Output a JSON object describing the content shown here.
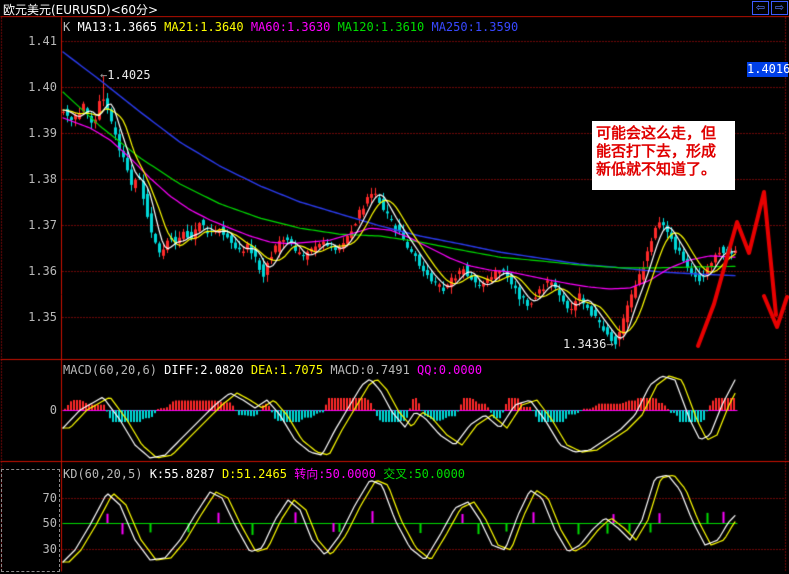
{
  "window": {
    "title": "欧元美元(EURUSD)<60分>",
    "back_icon": "⇦",
    "forward_icon": "⇨"
  },
  "colors": {
    "grid_red": "#e01010",
    "up_candle": "#ff2a2a",
    "down_candle": "#00d8d8",
    "white": "#ffffff",
    "yellow": "#ffff00",
    "magenta": "#ff00ff",
    "green": "#00dd00",
    "blue": "#2b3cf0",
    "gray_text": "#b8b8b8",
    "badge_bg": "#0040e8",
    "note_red": "#e00000",
    "arrow_red": "#e80000"
  },
  "main_panel": {
    "legend_k": "K",
    "legend": [
      {
        "label": "MA13:1.3665",
        "color": "#ffffff"
      },
      {
        "label": "MA21:1.3640",
        "color": "#ffff00"
      },
      {
        "label": "MA60:1.3630",
        "color": "#ff00ff"
      },
      {
        "label": "MA120:1.3610",
        "color": "#00dd00"
      },
      {
        "label": "MA250:1.3590",
        "color": "#3848ff"
      }
    ],
    "y_axis_labels": [
      "1.41",
      "1.40",
      "1.39",
      "1.38",
      "1.37",
      "1.36",
      "1.35"
    ],
    "price_badge": "1.4016",
    "high_label": {
      "arrow": "←",
      "text": "1.4025"
    },
    "low_label": {
      "text": "1.3436",
      "arrow": "→"
    },
    "note": {
      "lines": [
        "可能会这么走，但",
        "能否打下去，形成",
        "新低就不知道了。"
      ]
    }
  },
  "macd_panel": {
    "header": [
      {
        "label": "MACD(60,20,6)",
        "color": "#b8b8b8"
      },
      {
        "label": "DIFF:2.0820",
        "color": "#ffffff"
      },
      {
        "label": "DEA:1.7075",
        "color": "#ffff00"
      },
      {
        "label": "MACD:0.7491",
        "color": "#b8b8b8"
      },
      {
        "label": "QQ:0.0000",
        "color": "#ff00ff"
      }
    ],
    "zero_label": "0"
  },
  "kd_panel": {
    "header": [
      {
        "label": "KD(60,20,5)",
        "color": "#b8b8b8"
      },
      {
        "label": "K:55.8287",
        "color": "#ffffff"
      },
      {
        "label": "D:51.2465",
        "color": "#ffff00"
      },
      {
        "label": "转向:50.0000",
        "color": "#ff00ff"
      },
      {
        "label": "交叉:50.0000",
        "color": "#00dd00"
      }
    ],
    "y_axis_labels": [
      "70",
      "50",
      "30"
    ]
  },
  "chart_data": {
    "type": "candlestick+indicators",
    "symbol": "EURUSD",
    "period": "60分",
    "price_axis": {
      "top_price": 1.41,
      "price_step": 0.01,
      "labels": [
        1.41,
        1.4,
        1.39,
        1.38,
        1.37,
        1.36,
        1.35
      ]
    },
    "high_point": 1.4025,
    "low_point": 1.3436,
    "last_marked_price": 1.4016,
    "price_path": [
      [
        63,
        1.395
      ],
      [
        75,
        1.3928
      ],
      [
        85,
        1.3961
      ],
      [
        95,
        1.3917
      ],
      [
        103,
        1.3993
      ],
      [
        110,
        1.3939
      ],
      [
        118,
        1.3885
      ],
      [
        125,
        1.3841
      ],
      [
        133,
        1.3787
      ],
      [
        140,
        1.3809
      ],
      [
        148,
        1.3733
      ],
      [
        155,
        1.3667
      ],
      [
        162,
        1.3628
      ],
      [
        170,
        1.3678
      ],
      [
        178,
        1.365
      ],
      [
        185,
        1.3689
      ],
      [
        193,
        1.3667
      ],
      [
        200,
        1.3707
      ],
      [
        210,
        1.3678
      ],
      [
        220,
        1.3693
      ],
      [
        230,
        1.3672
      ],
      [
        240,
        1.3641
      ],
      [
        250,
        1.3657
      ],
      [
        258,
        1.362
      ],
      [
        265,
        1.3591
      ],
      [
        272,
        1.3635
      ],
      [
        280,
        1.3657
      ],
      [
        288,
        1.3672
      ],
      [
        295,
        1.3646
      ],
      [
        305,
        1.3628
      ],
      [
        315,
        1.365
      ],
      [
        325,
        1.3667
      ],
      [
        335,
        1.3641
      ],
      [
        345,
        1.3663
      ],
      [
        355,
        1.37
      ],
      [
        365,
        1.3743
      ],
      [
        372,
        1.3776
      ],
      [
        380,
        1.3759
      ],
      [
        388,
        1.3722
      ],
      [
        395,
        1.37
      ],
      [
        405,
        1.3667
      ],
      [
        415,
        1.3635
      ],
      [
        425,
        1.3602
      ],
      [
        435,
        1.3576
      ],
      [
        445,
        1.3559
      ],
      [
        455,
        1.3585
      ],
      [
        465,
        1.3607
      ],
      [
        472,
        1.3585
      ],
      [
        480,
        1.3563
      ],
      [
        490,
        1.358
      ],
      [
        500,
        1.3602
      ],
      [
        510,
        1.3585
      ],
      [
        520,
        1.3548
      ],
      [
        530,
        1.3526
      ],
      [
        540,
        1.3559
      ],
      [
        550,
        1.3576
      ],
      [
        558,
        1.3554
      ],
      [
        565,
        1.3533
      ],
      [
        572,
        1.3515
      ],
      [
        580,
        1.3548
      ],
      [
        588,
        1.3526
      ],
      [
        595,
        1.3504
      ],
      [
        602,
        1.3483
      ],
      [
        610,
        1.3461
      ],
      [
        618,
        1.3441
      ],
      [
        625,
        1.3493
      ],
      [
        632,
        1.3537
      ],
      [
        640,
        1.358
      ],
      [
        648,
        1.3635
      ],
      [
        655,
        1.3685
      ],
      [
        662,
        1.3707
      ],
      [
        670,
        1.3678
      ],
      [
        678,
        1.365
      ],
      [
        685,
        1.3624
      ],
      [
        692,
        1.3598
      ],
      [
        700,
        1.358
      ],
      [
        708,
        1.3602
      ],
      [
        715,
        1.3628
      ],
      [
        722,
        1.365
      ],
      [
        728,
        1.3635
      ],
      [
        735,
        1.3646
      ]
    ],
    "ma60": [
      [
        63,
        1.3933
      ],
      [
        90,
        1.3911
      ],
      [
        110,
        1.3885
      ],
      [
        130,
        1.3846
      ],
      [
        150,
        1.3802
      ],
      [
        170,
        1.3763
      ],
      [
        190,
        1.3733
      ],
      [
        210,
        1.3711
      ],
      [
        230,
        1.3693
      ],
      [
        250,
        1.3676
      ],
      [
        270,
        1.3663
      ],
      [
        290,
        1.3659
      ],
      [
        310,
        1.3663
      ],
      [
        330,
        1.3667
      ],
      [
        350,
        1.368
      ],
      [
        370,
        1.3693
      ],
      [
        390,
        1.3689
      ],
      [
        410,
        1.3672
      ],
      [
        430,
        1.365
      ],
      [
        450,
        1.3628
      ],
      [
        470,
        1.3611
      ],
      [
        490,
        1.3602
      ],
      [
        510,
        1.3598
      ],
      [
        530,
        1.3589
      ],
      [
        550,
        1.358
      ],
      [
        570,
        1.3572
      ],
      [
        590,
        1.3565
      ],
      [
        610,
        1.3561
      ],
      [
        630,
        1.3563
      ],
      [
        650,
        1.358
      ],
      [
        670,
        1.3607
      ],
      [
        690,
        1.3624
      ],
      [
        710,
        1.3633
      ],
      [
        735,
        1.363
      ]
    ],
    "ma120": [
      [
        63,
        1.3989
      ],
      [
        100,
        1.3915
      ],
      [
        140,
        1.3846
      ],
      [
        180,
        1.3789
      ],
      [
        220,
        1.3746
      ],
      [
        260,
        1.3715
      ],
      [
        300,
        1.3693
      ],
      [
        340,
        1.368
      ],
      [
        380,
        1.3676
      ],
      [
        420,
        1.3663
      ],
      [
        460,
        1.3646
      ],
      [
        500,
        1.363
      ],
      [
        540,
        1.3622
      ],
      [
        580,
        1.3613
      ],
      [
        620,
        1.3607
      ],
      [
        660,
        1.3607
      ],
      [
        700,
        1.3609
      ],
      [
        735,
        1.361
      ]
    ],
    "ma250": [
      [
        63,
        1.4076
      ],
      [
        100,
        1.4015
      ],
      [
        140,
        1.3946
      ],
      [
        180,
        1.388
      ],
      [
        220,
        1.3828
      ],
      [
        260,
        1.3785
      ],
      [
        300,
        1.375
      ],
      [
        340,
        1.3724
      ],
      [
        380,
        1.3698
      ],
      [
        420,
        1.3676
      ],
      [
        460,
        1.3659
      ],
      [
        500,
        1.3641
      ],
      [
        540,
        1.3628
      ],
      [
        580,
        1.3615
      ],
      [
        620,
        1.3607
      ],
      [
        660,
        1.3598
      ],
      [
        700,
        1.3593
      ],
      [
        735,
        1.359
      ]
    ],
    "macd_diff": [
      [
        63,
        -1.25
      ],
      [
        80,
        0.0
      ],
      [
        103,
        0.9
      ],
      [
        120,
        -0.69
      ],
      [
        135,
        -2.43
      ],
      [
        150,
        -3.33
      ],
      [
        165,
        -3.13
      ],
      [
        180,
        -2.08
      ],
      [
        200,
        -0.69
      ],
      [
        215,
        0.35
      ],
      [
        230,
        1.18
      ],
      [
        243,
        0.69
      ],
      [
        255,
        0.14
      ],
      [
        267,
        0.69
      ],
      [
        280,
        -0.35
      ],
      [
        295,
        -2.08
      ],
      [
        310,
        -2.92
      ],
      [
        322,
        -3.13
      ],
      [
        335,
        -1.39
      ],
      [
        350,
        0.35
      ],
      [
        362,
        1.74
      ],
      [
        370,
        2.15
      ],
      [
        380,
        1.39
      ],
      [
        392,
        -0.14
      ],
      [
        405,
        -1.18
      ],
      [
        415,
        -0.14
      ],
      [
        425,
        -0.56
      ],
      [
        440,
        -1.74
      ],
      [
        455,
        -2.43
      ],
      [
        470,
        -1.04
      ],
      [
        485,
        -0.35
      ],
      [
        500,
        -1.25
      ],
      [
        515,
        0.35
      ],
      [
        530,
        0.69
      ],
      [
        545,
        -0.69
      ],
      [
        560,
        -2.43
      ],
      [
        575,
        -2.92
      ],
      [
        590,
        -2.78
      ],
      [
        605,
        -2.08
      ],
      [
        620,
        -1.39
      ],
      [
        635,
        -0.35
      ],
      [
        650,
        1.74
      ],
      [
        662,
        2.36
      ],
      [
        675,
        2.08
      ],
      [
        690,
        -0.69
      ],
      [
        700,
        -2.08
      ],
      [
        710,
        -1.74
      ],
      [
        722,
        0.35
      ],
      [
        735,
        2.08
      ]
    ],
    "kd_k": [
      [
        63,
        19.4
      ],
      [
        75,
        28.8
      ],
      [
        90,
        48.4
      ],
      [
        107,
        73.5
      ],
      [
        120,
        64.1
      ],
      [
        135,
        36.7
      ],
      [
        150,
        21.0
      ],
      [
        165,
        22.6
      ],
      [
        180,
        36.7
      ],
      [
        195,
        56.3
      ],
      [
        210,
        74.3
      ],
      [
        222,
        69.6
      ],
      [
        235,
        48.4
      ],
      [
        250,
        27.3
      ],
      [
        262,
        30.4
      ],
      [
        275,
        52.4
      ],
      [
        288,
        68.0
      ],
      [
        300,
        60.2
      ],
      [
        312,
        36.7
      ],
      [
        325,
        24.9
      ],
      [
        340,
        40.6
      ],
      [
        355,
        64.1
      ],
      [
        370,
        83.7
      ],
      [
        382,
        79.8
      ],
      [
        395,
        52.4
      ],
      [
        410,
        30.4
      ],
      [
        425,
        21.0
      ],
      [
        440,
        40.6
      ],
      [
        455,
        61.8
      ],
      [
        468,
        66.5
      ],
      [
        480,
        52.4
      ],
      [
        492,
        32.7
      ],
      [
        505,
        28.8
      ],
      [
        518,
        56.3
      ],
      [
        530,
        75.9
      ],
      [
        542,
        69.6
      ],
      [
        555,
        44.5
      ],
      [
        568,
        27.3
      ],
      [
        580,
        32.7
      ],
      [
        592,
        44.5
      ],
      [
        605,
        53.9
      ],
      [
        618,
        46.1
      ],
      [
        630,
        36.7
      ],
      [
        642,
        52.4
      ],
      [
        655,
        85.3
      ],
      [
        668,
        87.6
      ],
      [
        680,
        75.9
      ],
      [
        692,
        52.4
      ],
      [
        705,
        32.7
      ],
      [
        718,
        36.7
      ],
      [
        728,
        50.0
      ],
      [
        735,
        55.8
      ]
    ],
    "kd_levels": [
      70,
      50,
      30
    ],
    "kd_spikes": [
      [
        107,
        "m",
        -1
      ],
      [
        122,
        "m",
        1
      ],
      [
        150,
        "g",
        1
      ],
      [
        188,
        "g",
        1
      ],
      [
        218,
        "m",
        -1
      ],
      [
        252,
        "g",
        1
      ],
      [
        295,
        "m",
        -1
      ],
      [
        333,
        "m",
        1
      ],
      [
        339,
        "g",
        1
      ],
      [
        372,
        "m",
        -1
      ],
      [
        420,
        "g",
        1
      ],
      [
        462,
        "m",
        -1
      ],
      [
        478,
        "g",
        1
      ],
      [
        506,
        "g",
        1
      ],
      [
        533,
        "m",
        -1
      ],
      [
        578,
        "g",
        1
      ],
      [
        607,
        "g",
        1
      ],
      [
        613,
        "m",
        -1
      ],
      [
        629,
        "g",
        1
      ],
      [
        650,
        "g",
        1
      ],
      [
        659,
        "m",
        -1
      ],
      [
        707,
        "g",
        -1
      ],
      [
        723,
        "m",
        -1
      ]
    ],
    "trend_arrow": {
      "points": [
        [
          698,
          346
        ],
        [
          714,
          304
        ],
        [
          737,
          222
        ],
        [
          749,
          253
        ],
        [
          764,
          192
        ],
        [
          776,
          315
        ]
      ],
      "head": [
        [
          764,
          296
        ],
        [
          777,
          327
        ],
        [
          787,
          297
        ]
      ]
    }
  }
}
